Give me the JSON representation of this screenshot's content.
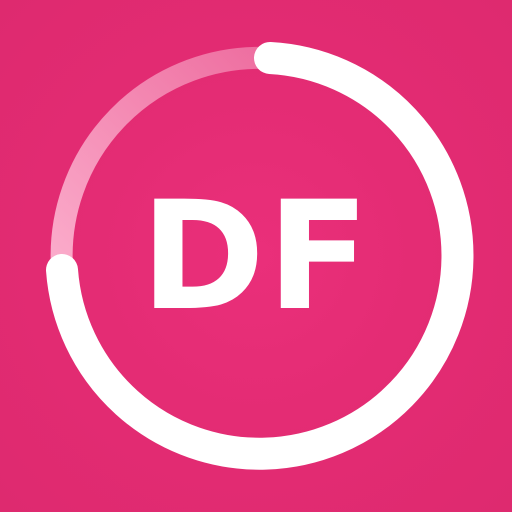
{
  "icon": {
    "monogram": "DF",
    "progress_fraction": 0.83,
    "colors": {
      "background": "#e42a74",
      "ring_filled": "#ffffff",
      "ring_track_start": "#f07aa8",
      "ring_track_end": "#ffc2da",
      "text": "#ffffff"
    }
  }
}
